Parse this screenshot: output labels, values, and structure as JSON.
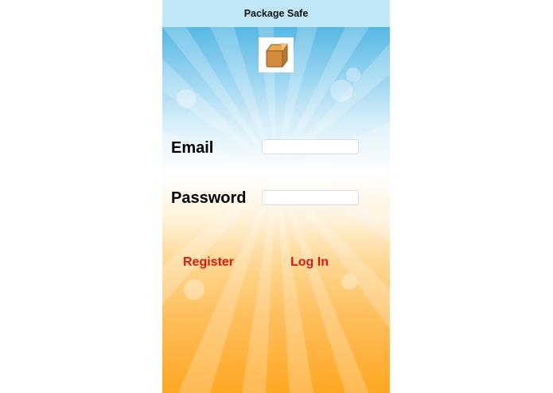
{
  "app": {
    "title": "Package Safe",
    "logo_icon": "package-box-icon"
  },
  "login_form": {
    "email_label": "Email",
    "email_value": "",
    "email_placeholder": "",
    "password_label": "Password",
    "password_value": "",
    "password_placeholder": ""
  },
  "actions": {
    "register_label": "Register",
    "login_label": "Log In"
  },
  "colors": {
    "accent": "#e0170f",
    "navbar": "#bfe8f8",
    "sky_top": "#56b7e4",
    "sun_bottom": "#ffa722"
  }
}
